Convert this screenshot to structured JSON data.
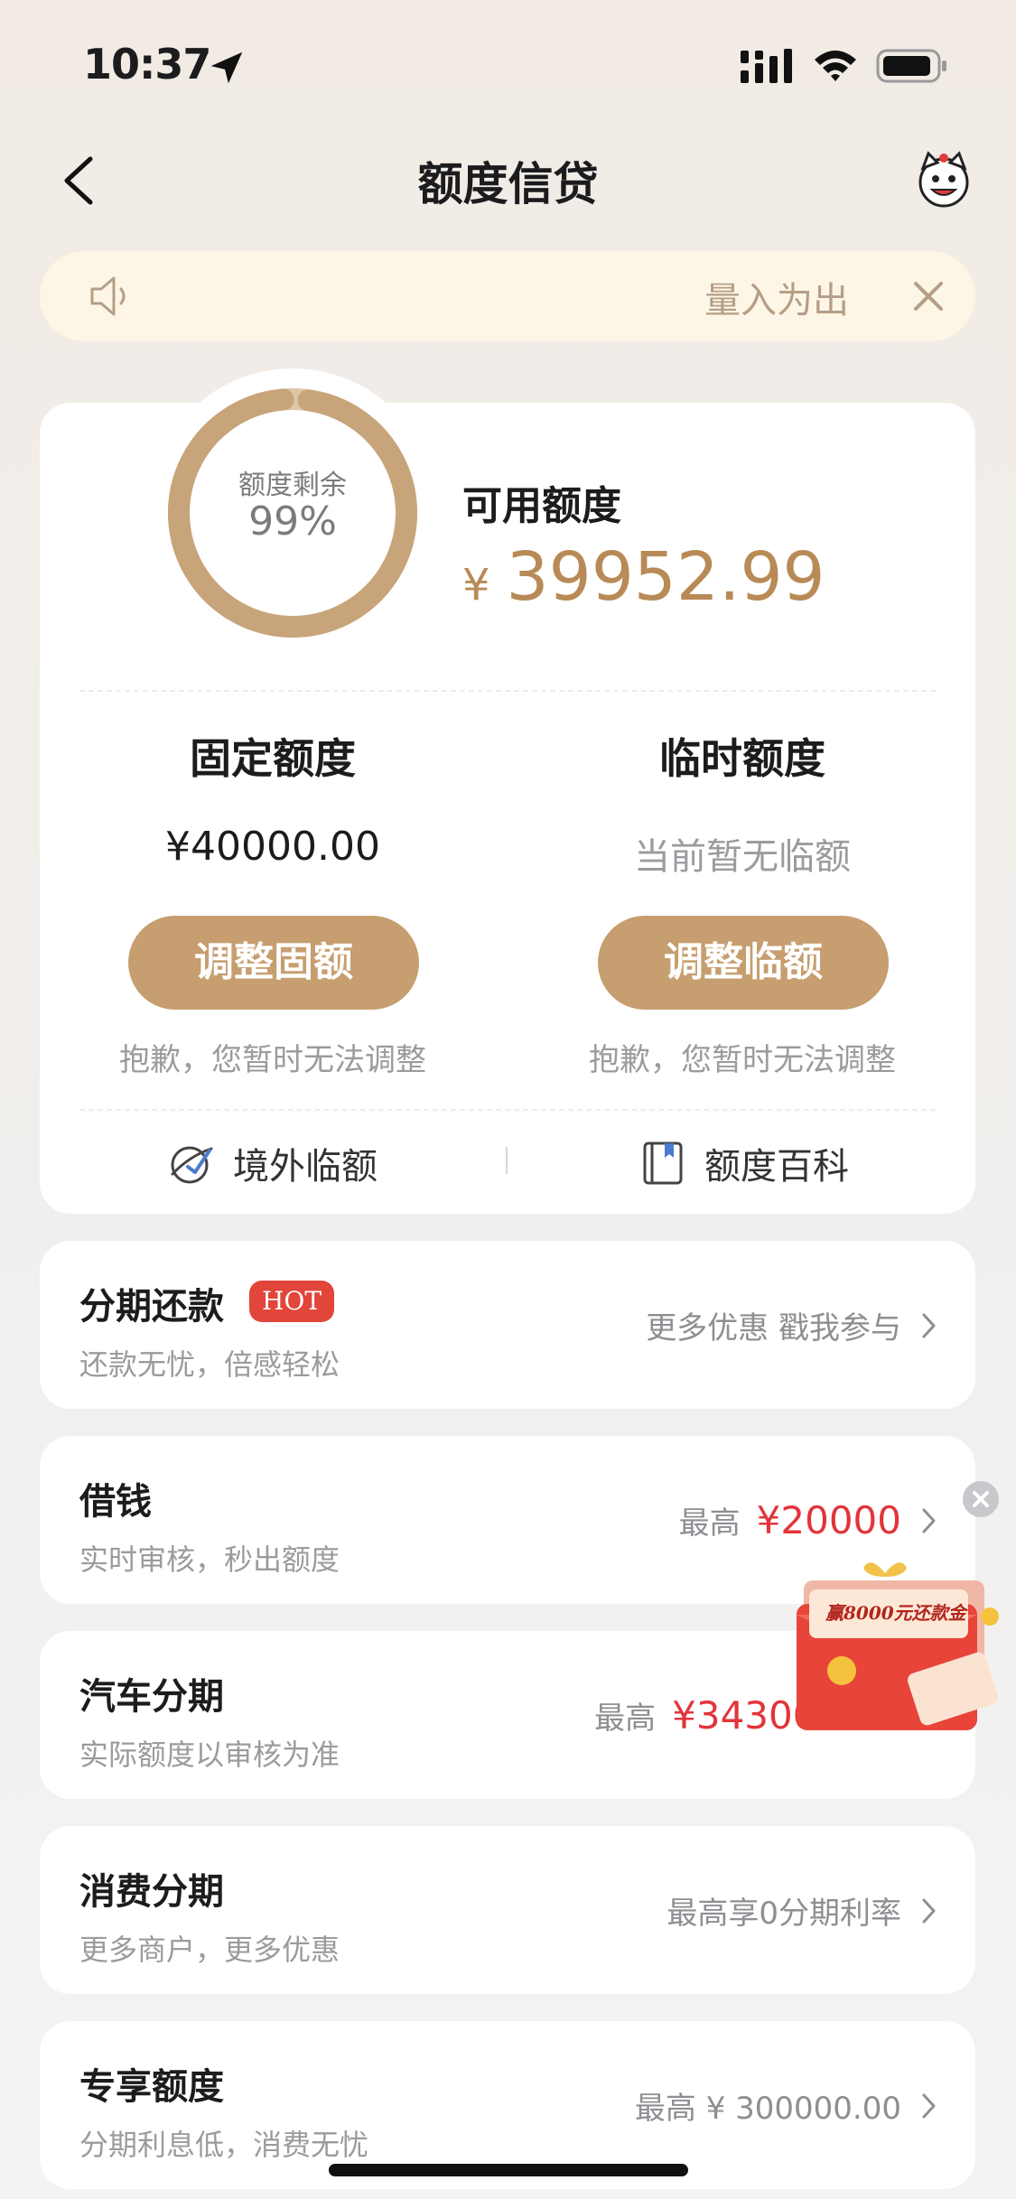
{
  "status_bar": {
    "time": "10:37"
  },
  "nav": {
    "title": "额度信贷"
  },
  "notice": {
    "text": "量入为出"
  },
  "credit": {
    "ring_label": "额度剩余",
    "ring_percent_text": "99%",
    "ring_fraction": 0.99,
    "available_label": "可用额度",
    "available_currency": "¥",
    "available_amount": "39952.99",
    "fixed": {
      "title": "固定额度",
      "value": "¥40000.00",
      "button": "调整固额",
      "note": "抱歉，您暂时无法调整"
    },
    "temp": {
      "title": "临时额度",
      "value": "当前暂无临额",
      "button": "调整临额",
      "note": "抱歉，您暂时无法调整"
    },
    "links": {
      "overseas": "境外临额",
      "wiki": "额度百科"
    }
  },
  "rows": [
    {
      "title": "分期还款",
      "badge": "HOT",
      "subtitle": "还款无忧，倍感轻松",
      "right_text": "更多优惠 戳我参与",
      "right_amount": ""
    },
    {
      "title": "借钱",
      "subtitle": "实时审核，秒出额度",
      "right_text": "最高",
      "right_amount": "¥20000"
    },
    {
      "title": "汽车分期",
      "subtitle": "实际额度以审核为准",
      "right_text": "最高",
      "right_amount": "¥343000.00"
    },
    {
      "title": "消费分期",
      "subtitle": "更多商户，更多优惠",
      "right_text": "最高享0分期利率",
      "right_amount": ""
    },
    {
      "title": "专享额度",
      "subtitle": "分期利息低，消费无忧",
      "right_text": "最高 ¥ 300000.00",
      "right_amount": ""
    }
  ],
  "promo": {
    "text": "赢8000元还款金"
  },
  "colors": {
    "accent": "#c69e6f",
    "amount": "#b88a56",
    "red": "#e2343a",
    "notice_bg": "#fdf6e6"
  }
}
